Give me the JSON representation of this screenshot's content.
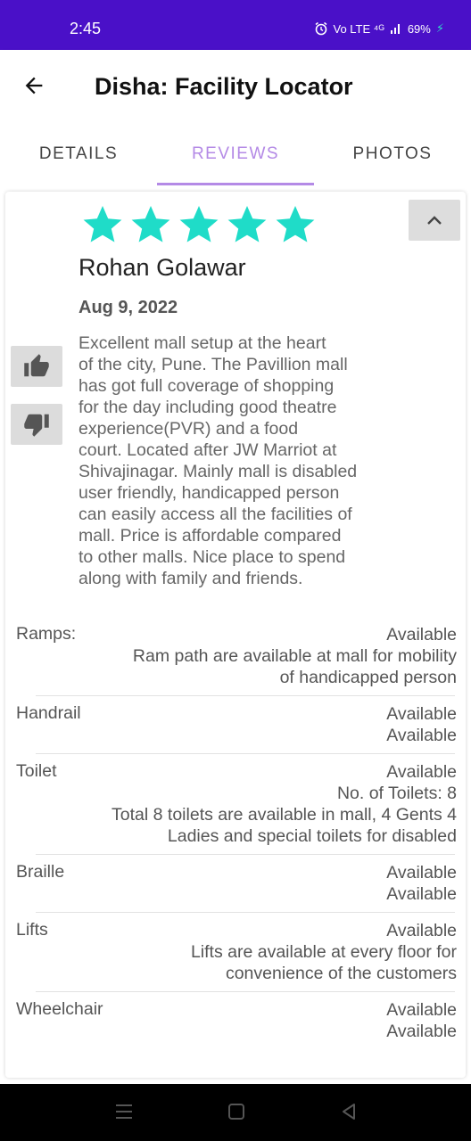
{
  "status_bar": {
    "time": "2:45",
    "alarm_icon": "alarm-icon",
    "network_text": "Vo LTE ⁴ᴳ",
    "battery_text": "69%",
    "accent": "#4a10c8"
  },
  "app_bar": {
    "back_icon": "arrow-left-icon",
    "title": "Disha: Facility Locator"
  },
  "tabs": [
    {
      "label": "DETAILS",
      "selected": false
    },
    {
      "label": "REVIEWS",
      "selected": true
    },
    {
      "label": "PHOTOS",
      "selected": false
    }
  ],
  "review": {
    "rating": 5,
    "rating_max": 5,
    "star_color": "#1fdcc8",
    "reviewer": "Rohan Golawar",
    "date": "Aug 9, 2022",
    "text_lines": [
      "Excellent mall setup at the heart",
      "of the city, Pune. The Pavillion mall",
      "has got full coverage of shopping",
      "for the day including good theatre",
      "experience(PVR) and a food",
      "court. Located after JW Marriot at",
      "Shivajinagar. Mainly mall is disabled",
      "user friendly, handicapped person",
      "can easily access all the facilities of",
      "mall. Price is affordable compared",
      "to other malls. Nice place to spend",
      "along with family and friends."
    ]
  },
  "features": [
    {
      "name": "Ramps:",
      "lines": [
        "Available",
        "Ram path are available at mall for mobility",
        "of handicapped person"
      ]
    },
    {
      "name": "Handrail",
      "lines": [
        "Available",
        "Available"
      ]
    },
    {
      "name": "Toilet",
      "lines": [
        "Available",
        "No. of Toilets: 8",
        "Total 8 toilets are available in mall, 4 Gents 4",
        "Ladies and special toilets for disabled"
      ]
    },
    {
      "name": "Braille",
      "lines": [
        "Available",
        "Available"
      ]
    },
    {
      "name": "Lifts",
      "lines": [
        "Available",
        "Lifts are available at every floor for",
        "convenience of the customers"
      ]
    },
    {
      "name": "Wheelchair",
      "lines": [
        "Available",
        "Available"
      ]
    }
  ]
}
